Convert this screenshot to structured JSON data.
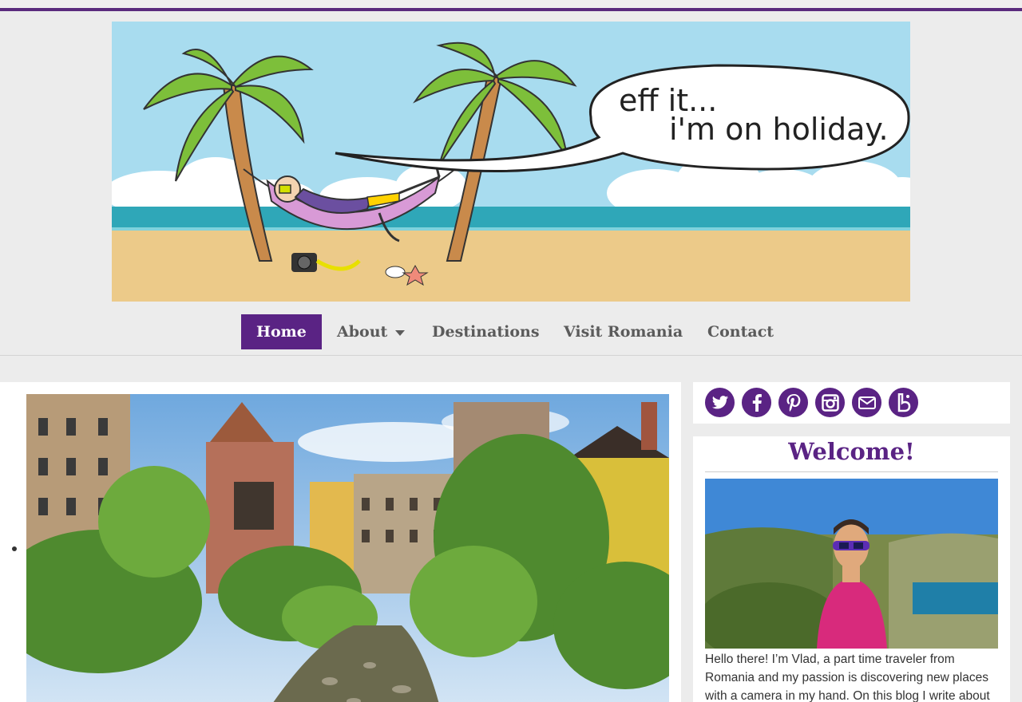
{
  "header": {
    "speech_line_1": "eff it...",
    "speech_line_2": "i'm on holiday."
  },
  "nav": {
    "items": [
      {
        "label": "Home",
        "active": true
      },
      {
        "label": "About",
        "has_dropdown": true
      },
      {
        "label": "Destinations"
      },
      {
        "label": "Visit Romania"
      },
      {
        "label": "Contact"
      }
    ]
  },
  "social": {
    "icons": [
      "twitter-icon",
      "facebook-icon",
      "pinterest-icon",
      "instagram-icon",
      "email-icon",
      "bloglovin-icon"
    ]
  },
  "sidebar": {
    "welcome_title": "Welcome!",
    "intro_text": "Hello there! I’m Vlad, a part time traveler from Romania and my passion is discovering new places with a camera in my hand. On this blog I write about"
  },
  "colors": {
    "brand_purple": "#5a2384",
    "nav_text": "#5b5b5b",
    "page_bg": "#ececec"
  }
}
